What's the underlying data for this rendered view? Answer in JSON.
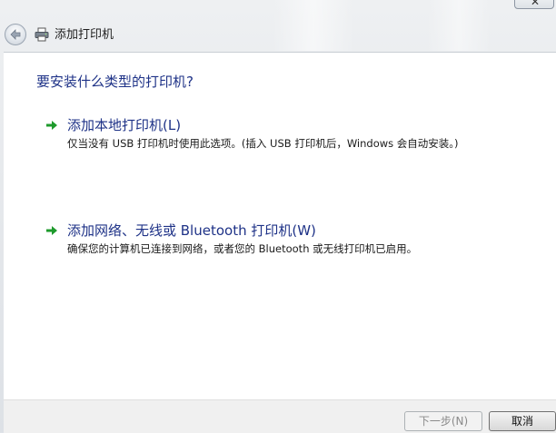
{
  "window": {
    "title": "添加打印机",
    "close_label": "✕"
  },
  "content": {
    "question": "要安装什么类型的打印机?",
    "options": [
      {
        "title": "添加本地打印机(L)",
        "description": "仅当没有 USB 打印机时使用此选项。(插入 USB 打印机后，Windows 会自动安装。)"
      },
      {
        "title": "添加网络、无线或 Bluetooth 打印机(W)",
        "description": "确保您的计算机已连接到网络，或者您的 Bluetooth 或无线打印机已启用。"
      }
    ]
  },
  "footer": {
    "next_label": "下一步(N)",
    "cancel_label": "取消"
  },
  "icons": {
    "back": "back-arrow-icon",
    "printer": "printer-icon",
    "option_arrow": "green-arrow-icon"
  },
  "colors": {
    "heading": "#1e3287",
    "arrow": "#1e9a2c"
  }
}
